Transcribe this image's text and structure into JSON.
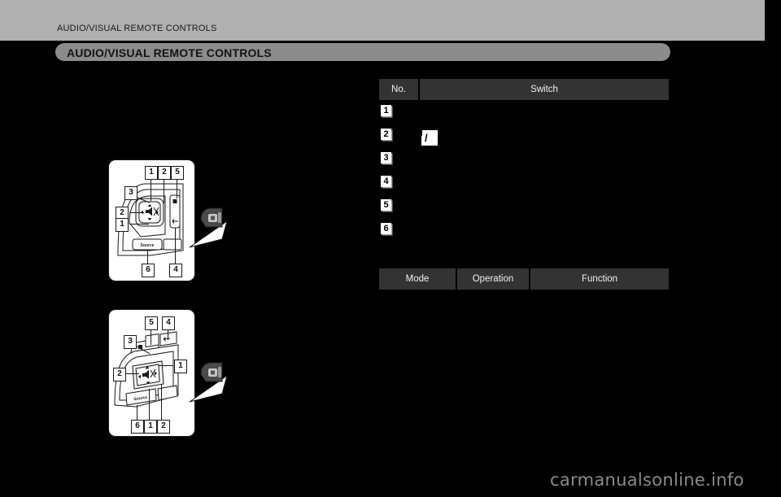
{
  "header": {
    "running_head": "AUDIO/VISUAL REMOTE CONTROLS",
    "section_title": "AUDIO/VISUAL REMOTE CONTROLS"
  },
  "switch_table": {
    "columns": [
      "No.",
      "Switch"
    ],
    "rows": [
      {
        "no": "1",
        "switch": ""
      },
      {
        "no": "2",
        "switch": "◀ / ▶"
      },
      {
        "no": "3",
        "switch": ""
      },
      {
        "no": "4",
        "switch": ""
      },
      {
        "no": "5",
        "switch": ""
      },
      {
        "no": "6",
        "switch": ""
      }
    ]
  },
  "mode_table": {
    "columns": [
      "Mode",
      "Operation",
      "Function"
    ],
    "rows": []
  },
  "illustration_1": {
    "name": "steering-wheel-audio-controls-type-a",
    "callouts": [
      "1",
      "2",
      "5",
      "3",
      "2",
      "1",
      "6",
      "4"
    ],
    "source_button_label": "Source"
  },
  "illustration_2": {
    "name": "steering-wheel-audio-controls-type-b",
    "callouts": [
      "5",
      "4",
      "3",
      "1",
      "2",
      "6",
      "1",
      "2"
    ],
    "source_button_label": "Source"
  },
  "watermark": {
    "text": "carmanualsonline.info"
  }
}
